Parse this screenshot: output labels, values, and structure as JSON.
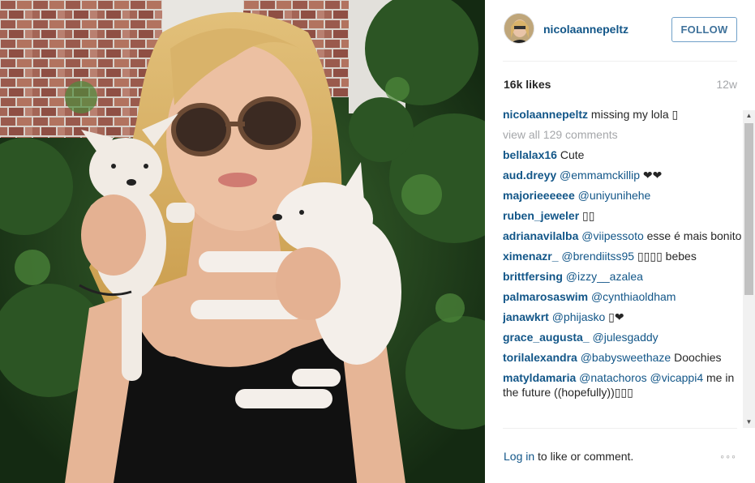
{
  "post": {
    "username": "nicolaannepeltz",
    "follow_label": "FOLLOW",
    "likes": "16k likes",
    "time_ago": "12w",
    "view_all": "view all 129 comments"
  },
  "caption": {
    "user": "nicolaannepeltz",
    "text": " missing my lola ▯"
  },
  "comments": [
    {
      "user": "bellalax16",
      "mention": "",
      "text": " Cute"
    },
    {
      "user": "aud.dreyy",
      "mention": " @emmamckillip",
      "text": " ❤❤"
    },
    {
      "user": "majorieeeeee",
      "mention": " @uniyunihehe",
      "text": ""
    },
    {
      "user": "ruben_jeweler",
      "mention": "",
      "text": " ▯▯"
    },
    {
      "user": "adrianavilalba",
      "mention": " @viipessoto",
      "text": " esse é mais bonito"
    },
    {
      "user": "ximenazr_",
      "mention": " @brendiitss95",
      "text": " ▯▯▯▯ bebes"
    },
    {
      "user": "brittfersing",
      "mention": " @izzy__azalea",
      "text": ""
    },
    {
      "user": "palmarosaswim",
      "mention": " @cynthiaoldham",
      "text": ""
    },
    {
      "user": "janawkrt",
      "mention": " @phijasko",
      "text": " ▯❤"
    },
    {
      "user": "grace_augusta_",
      "mention": " @julesgaddy",
      "text": ""
    },
    {
      "user": "torilalexandra",
      "mention": " @babysweethaze",
      "text": " Doochies"
    },
    {
      "user": "matyldamaria",
      "mention": " @natachoros @vicappi4",
      "text": " me in the future ((hopefully))▯▯▯"
    }
  ],
  "footer": {
    "login_link": "Log in",
    "login_text": " to like or comment.",
    "more": "◦◦◦"
  },
  "icons": {
    "more": "more-options-icon",
    "scroll_up": "arrow-up-icon",
    "scroll_down": "arrow-down-icon"
  },
  "colors": {
    "link": "#125688",
    "follow_border": "#70a0c8",
    "muted": "#a5a7aa"
  }
}
